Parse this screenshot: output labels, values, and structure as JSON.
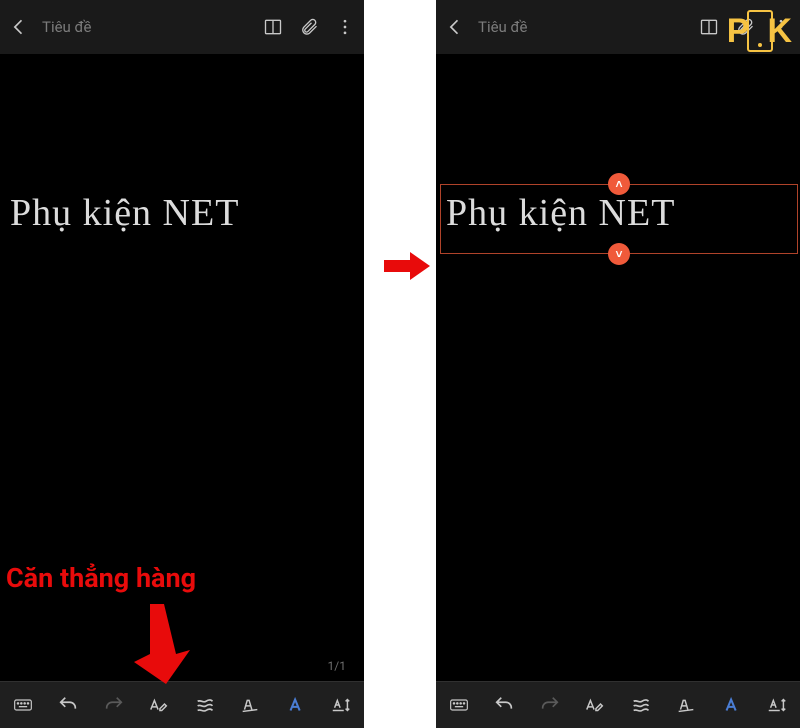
{
  "header": {
    "title_placeholder": "Tiêu đề",
    "page_indicator": "1/1"
  },
  "handwriting_text": "Phụ kiện NET",
  "annotation": {
    "label": "Căn thẳng hàng"
  },
  "watermark": {
    "p": "P",
    "k": "K"
  },
  "icons": {
    "back": "back-icon",
    "reader": "reader-icon",
    "attach": "paperclip-icon",
    "more": "more-vert-icon",
    "keyboard": "keyboard-icon",
    "undo": "undo-icon",
    "redo": "redo-icon",
    "pen_text": "pen-text-icon",
    "align": "align-icon",
    "slant": "slant-text-icon",
    "style_a": "style-a-icon",
    "baseline": "baseline-icon"
  },
  "selection": {
    "handle_up": "˄",
    "handle_down": "˅"
  }
}
